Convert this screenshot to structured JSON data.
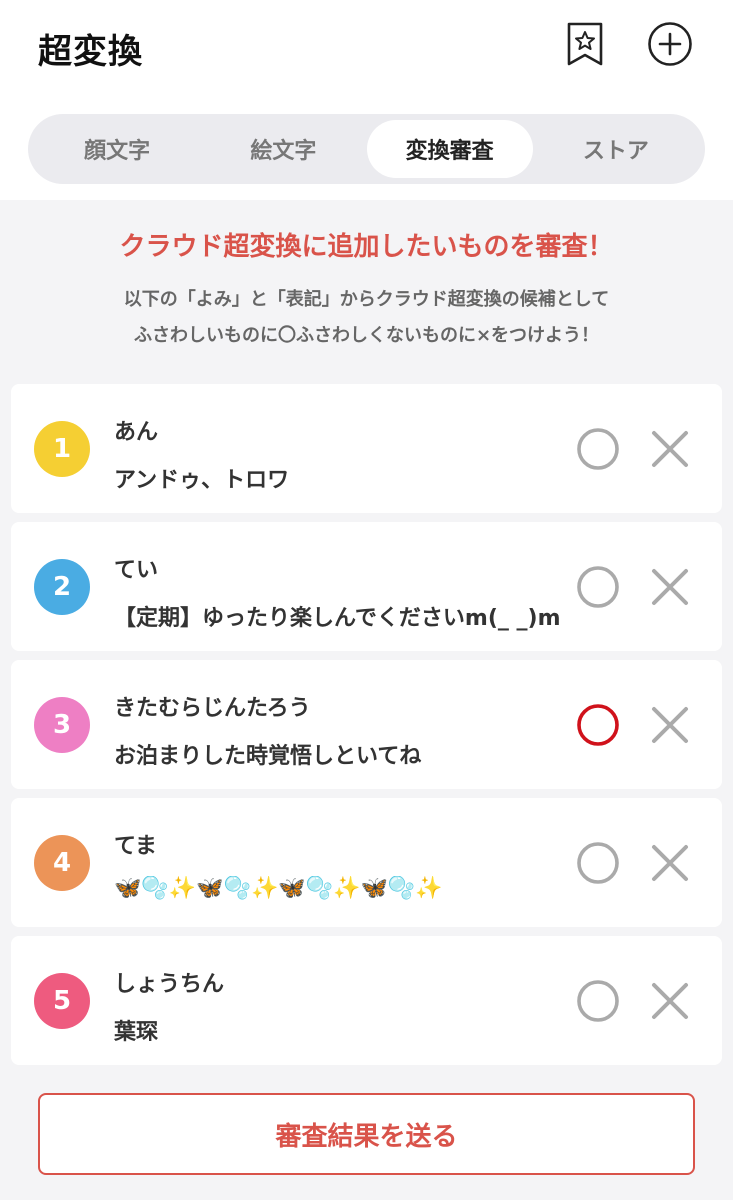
{
  "header": {
    "title": "超変換",
    "bookmark_icon": "bookmark-star-icon",
    "add_icon": "plus-circle-icon"
  },
  "tabs": [
    {
      "label": "顔文字",
      "active": false
    },
    {
      "label": "絵文字",
      "active": false
    },
    {
      "label": "変換審査",
      "active": true
    },
    {
      "label": "ストア",
      "active": false
    }
  ],
  "intro": {
    "heading": "クラウド超変換に追加したいものを審査！",
    "line1": "以下の「よみ」と「表記」からクラウド超変換の候補として",
    "line2": "ふさわしいものに〇ふさわしくないものに×をつけよう！"
  },
  "items": [
    {
      "number": "1",
      "color": "#f5cf33",
      "yomi": "あん",
      "hyoki": "アンドゥ、トロワ",
      "selected": "none"
    },
    {
      "number": "2",
      "color": "#4aace3",
      "yomi": "てい",
      "hyoki": "【定期】ゆったり楽しんでくださいm(_ _)m",
      "selected": "none"
    },
    {
      "number": "3",
      "color": "#ee7fc4",
      "yomi": "きたむらじんたろう",
      "hyoki": "お泊まりした時覚悟しといてね",
      "selected": "o"
    },
    {
      "number": "4",
      "color": "#ec9458",
      "yomi": "てま",
      "hyoki": "🦋🫧✨🦋🫧✨🦋🫧✨🦋🫧✨",
      "selected": "none"
    },
    {
      "number": "5",
      "color": "#ee5b7f",
      "yomi": "しょうちん",
      "hyoki": "葉琛",
      "selected": "none"
    }
  ],
  "colors": {
    "accent": "#d9534a",
    "selected_o": "#d0121b",
    "unselected": "#aaaaaa"
  },
  "submit_label": "審査結果を送る"
}
